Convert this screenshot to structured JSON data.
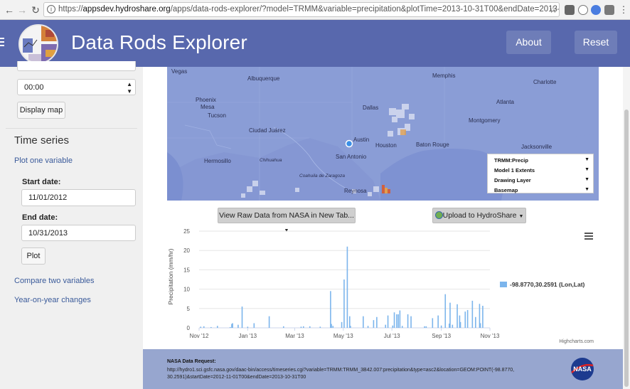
{
  "browser": {
    "url_scheme": "https://",
    "url_host": "appsdev.hydroshare.org",
    "url_rest": "/apps/data-rods-explorer/?model=TRMM&variable=precipitation&plotTime=2013-10-31T00&endDate=2013-10-31T23&sta..."
  },
  "header": {
    "title": "Data Rods Explorer",
    "about_label": "About",
    "reset_label": "Reset"
  },
  "sidebar": {
    "time_value": "00:00",
    "display_map_label": "Display map",
    "time_series_heading": "Time series",
    "plot_one_link": "Plot one variable",
    "start_label": "Start date:",
    "start_value": "11/01/2012",
    "end_label": "End date:",
    "end_value": "10/31/2013",
    "plot_label": "Plot",
    "compare_link": "Compare two variables",
    "yoy_link": "Year-on-year changes"
  },
  "map": {
    "cities": [
      "Albuquerque",
      "Phoenix",
      "Mesa",
      "Tucson",
      "Ciudad Juárez",
      "Dallas",
      "Austin",
      "San Antonio",
      "Houston",
      "Baton Rouge",
      "Memphis",
      "Atlanta",
      "Charlotte",
      "Montgomery",
      "Jacksonville",
      "Hermosillo",
      "Reynosa",
      "Vegas",
      "Chihuahua",
      "Coahuila de Zaragoza"
    ],
    "layers": [
      "TRMM:Precip",
      "Model 1 Extents",
      "Drawing Layer",
      "Basemap"
    ]
  },
  "buttons": {
    "view_raw": "View Raw Data from NASA in New Tab...",
    "upload": "Upload to HydroShare"
  },
  "chart_data": {
    "type": "bar",
    "ylabel": "Precipitation (mm/hr)",
    "ylim": [
      0,
      25
    ],
    "yticks": [
      "0",
      "5",
      "10",
      "15",
      "20",
      "25"
    ],
    "xticks": [
      "Nov '12",
      "Jan '13",
      "Mar '13",
      "May '13",
      "Jul '13",
      "Sep '13",
      "Nov '13"
    ],
    "series": [
      {
        "name": "-98.8770,30.2591 (Lon,Lat)",
        "color": "#7cb5ec"
      }
    ],
    "x": [
      "2012-11-03",
      "2012-11-07",
      "2012-11-16",
      "2012-11-24",
      "2012-12-10",
      "2012-12-12",
      "2012-12-13",
      "2012-12-20",
      "2012-12-25",
      "2013-01-01",
      "2013-01-09",
      "2013-01-28",
      "2013-02-15",
      "2013-03-09",
      "2013-03-12",
      "2013-03-20",
      "2013-04-02",
      "2013-04-15",
      "2013-04-16",
      "2013-04-18",
      "2013-04-29",
      "2013-05-02",
      "2013-05-06",
      "2013-05-09",
      "2013-05-10",
      "2013-05-26",
      "2013-06-01",
      "2013-06-08",
      "2013-06-12",
      "2013-06-23",
      "2013-06-26",
      "2013-07-02",
      "2013-07-04",
      "2013-07-07",
      "2013-07-09",
      "2013-07-11",
      "2013-07-14",
      "2013-07-21",
      "2013-07-25",
      "2013-08-11",
      "2013-08-13",
      "2013-08-21",
      "2013-08-28",
      "2013-09-01",
      "2013-09-06",
      "2013-09-11",
      "2013-09-12",
      "2013-09-15",
      "2013-09-21",
      "2013-09-24",
      "2013-09-25",
      "2013-10-01",
      "2013-10-04",
      "2013-10-10",
      "2013-10-14",
      "2013-10-19",
      "2013-10-20",
      "2013-10-23"
    ],
    "values": [
      0.3,
      0.4,
      0.2,
      0.5,
      0.2,
      1.0,
      1.2,
      0.8,
      5.5,
      0.3,
      1.2,
      3.0,
      0.4,
      0.3,
      0.4,
      0.4,
      0.3,
      9.5,
      1.0,
      0.5,
      1.5,
      12.5,
      21.0,
      3.0,
      0.5,
      3.0,
      0.5,
      2.0,
      2.8,
      0.8,
      3.2,
      0.6,
      4.0,
      3.5,
      3.5,
      4.5,
      0.5,
      3.5,
      3.0,
      0.4,
      0.4,
      2.5,
      3.2,
      0.6,
      8.7,
      1.1,
      6.5,
      0.8,
      6.1,
      3.2,
      1.5,
      4.2,
      4.6,
      7.0,
      2.8,
      6.2,
      1.2,
      5.7
    ],
    "credit": "Highcharts.com"
  },
  "footer": {
    "title": "NASA Data Request:",
    "url": "http://hydro1.sci.gsfc.nasa.gov/daac-bin/access/timeseries.cgi?variable=TRMM:TRMM_3B42.007:precipitation&type=asc2&location=GEOM:POINT(-98.8770, 30.2591)&startDate=2012-11-01T00&endDate=2013-10-31T00",
    "logo_text": "NASA"
  }
}
